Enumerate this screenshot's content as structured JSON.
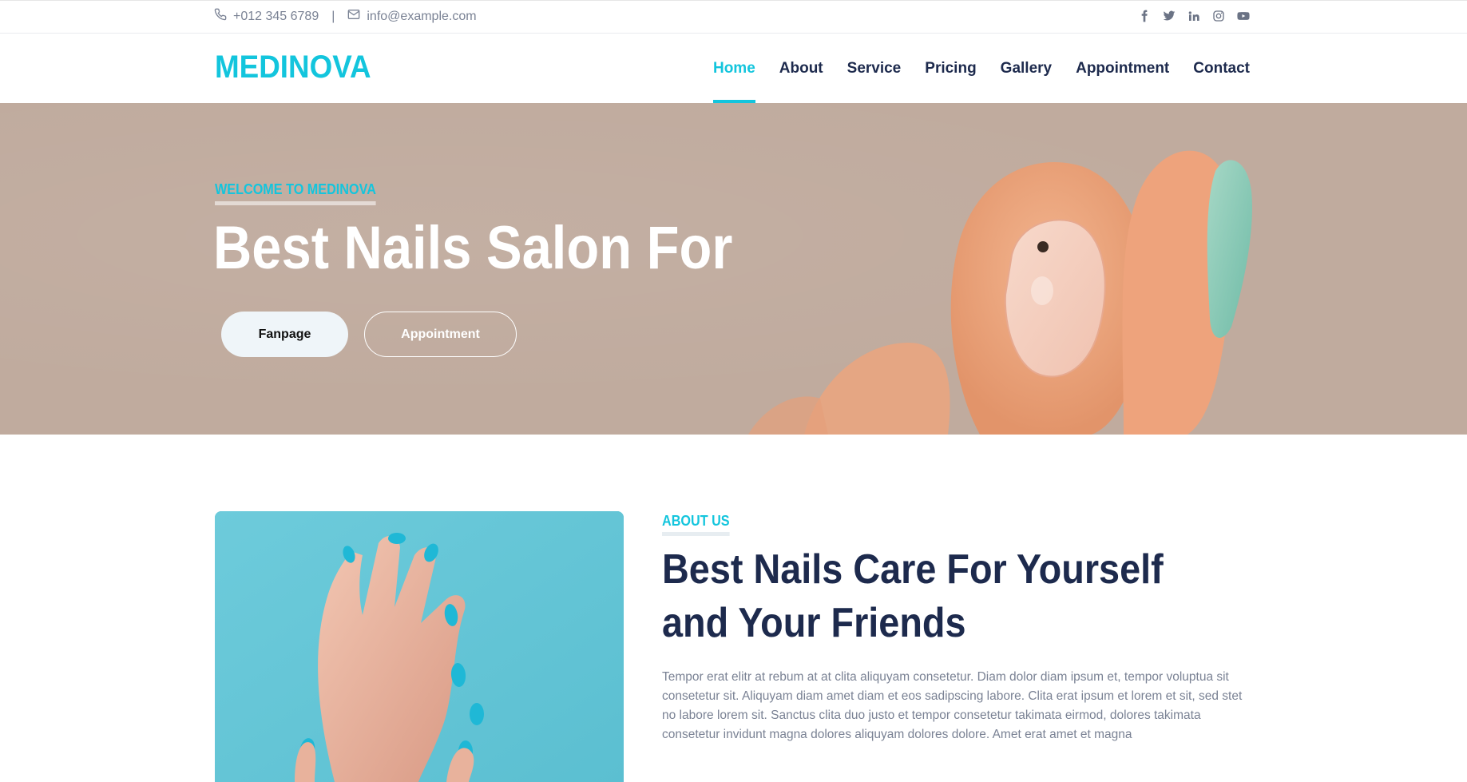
{
  "topbar": {
    "phone": "+012 345 6789",
    "separator": "|",
    "email": "info@example.com",
    "social_icons": [
      "facebook-icon",
      "twitter-icon",
      "linkedin-icon",
      "instagram-icon",
      "youtube-icon"
    ]
  },
  "nav": {
    "brand": "MEDINOVA",
    "items": [
      {
        "label": "Home",
        "active": true
      },
      {
        "label": "About"
      },
      {
        "label": "Service"
      },
      {
        "label": "Pricing"
      },
      {
        "label": "Gallery"
      },
      {
        "label": "Appointment"
      },
      {
        "label": "Contact"
      }
    ]
  },
  "hero": {
    "eyebrow": "WELCOME TO MEDINOVA",
    "title": "Best Nails Salon For",
    "buttons": {
      "fanpage": "Fanpage",
      "appointment": "Appointment"
    }
  },
  "about": {
    "eyebrow": "ABOUT US",
    "title": "Best Nails Care For Yourself and Your Friends",
    "text": "Tempor erat elitr at rebum at at clita aliquyam consetetur. Diam dolor diam ipsum et, tempor voluptua sit consetetur sit. Aliquyam diam amet diam et eos sadipscing labore. Clita erat ipsum et lorem et sit, sed stet no labore lorem sit. Sanctus clita duo justo et tempor consetetur takimata eirmod, dolores takimata consetetur invidunt magna dolores aliquyam dolores dolore. Amet erat amet et magna"
  },
  "colors": {
    "accent": "#13c5dd",
    "dark": "#1d2a4d",
    "muted": "#7a8294",
    "hero_bg": "#c0ab9e"
  }
}
